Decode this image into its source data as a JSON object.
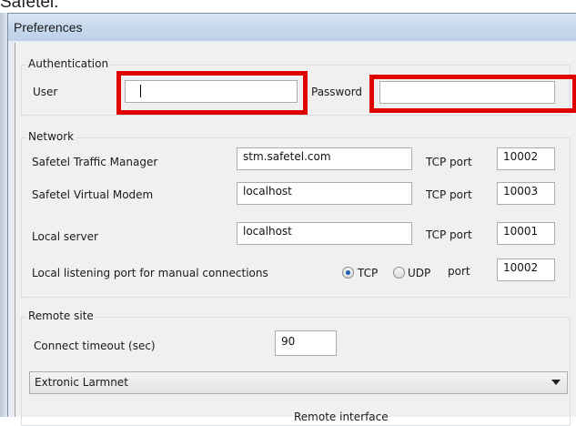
{
  "background_caption": "Safetel.",
  "window": {
    "title": "Preferences"
  },
  "authentication": {
    "group_label": "Authentication",
    "user_label": "User",
    "user_value": "",
    "password_label": "Password",
    "password_value": ""
  },
  "network": {
    "group_label": "Network",
    "rows": [
      {
        "label": "Safetel Traffic Manager",
        "host": "stm.safetel.com",
        "port_label": "TCP port",
        "port": "10002"
      },
      {
        "label": "Safetel Virtual Modem",
        "host": "localhost",
        "port_label": "TCP port",
        "port": "10003"
      },
      {
        "label": "Local server",
        "host": "localhost",
        "port_label": "TCP port",
        "port": "10001"
      }
    ],
    "listening_label": "Local listening port for manual connections",
    "tcp_label": "TCP",
    "udp_label": "UDP",
    "selected_protocol": "TCP",
    "port_label": "port",
    "listening_port": "10002"
  },
  "remote_site": {
    "group_label": "Remote site",
    "timeout_label": "Connect timeout (sec)",
    "timeout_value": "90",
    "device_selected": "Extronic Larmnet",
    "interface_label": "Remote interface"
  },
  "colors": {
    "highlight_box": "#e00000",
    "radio_selected": "#1e5fb4"
  }
}
